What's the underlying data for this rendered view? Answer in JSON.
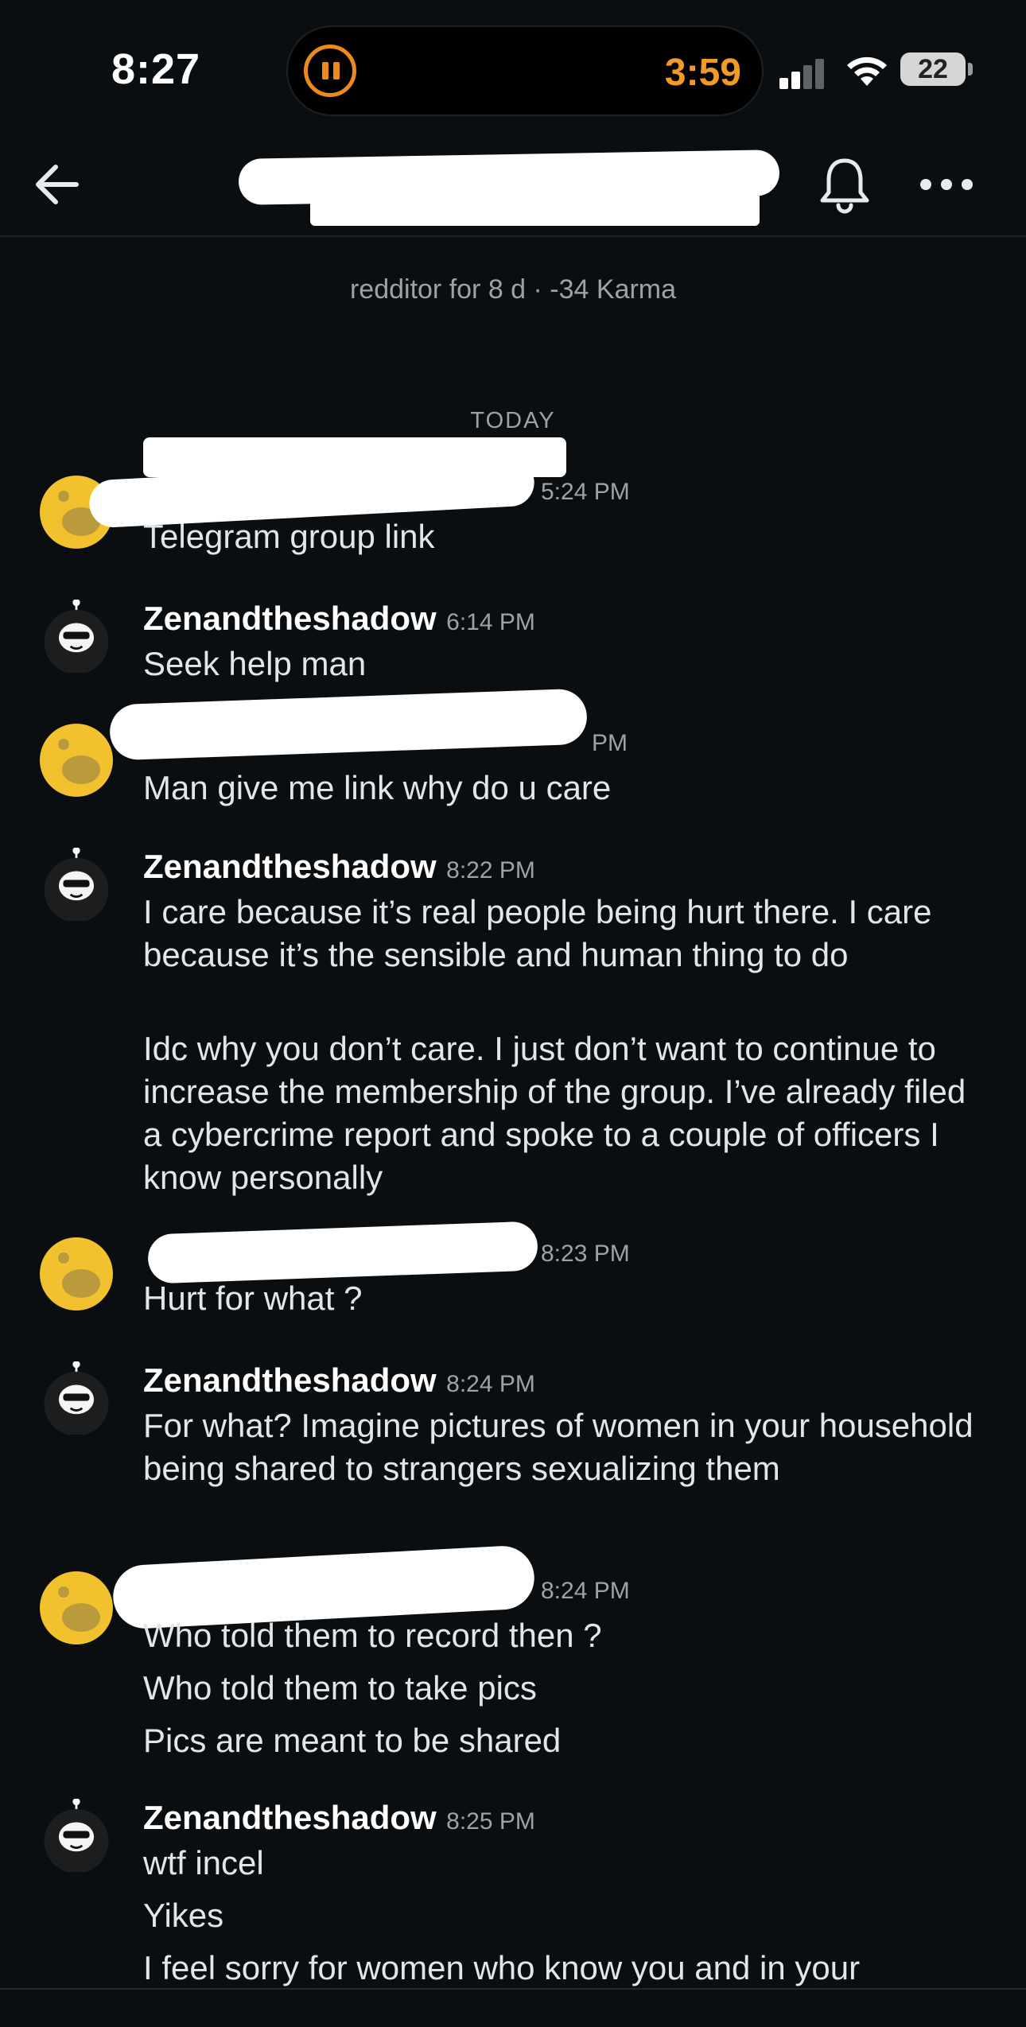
{
  "status_bar": {
    "time": "8:27",
    "island_timer": "3:59",
    "battery": "22",
    "accent_color": "#f19a25"
  },
  "nav": {
    "back_icon": "arrow-left-icon",
    "bell_icon": "bell-icon",
    "more_icon": "ellipsis-icon",
    "title": "[redacted username]"
  },
  "profile": {
    "subtitle": "redditor for 8 d · -34 Karma"
  },
  "divider": "TODAY",
  "messages": [
    {
      "user": "",
      "time": "5:24 PM",
      "lines": [
        "Telegram group link"
      ]
    },
    {
      "user": "Zenandtheshadow",
      "time": "6:14 PM",
      "lines": [
        "Seek help man"
      ]
    },
    {
      "user": "",
      "time": "PM",
      "lines": [
        "Man give me link why do u care"
      ]
    },
    {
      "user": "Zenandtheshadow",
      "time": "8:22 PM",
      "lines": [
        "I care because it’s real people being hurt there. I care because it’s the sensible and human thing to do",
        "Idc why you don’t care. I just don’t want to continue to increase the membership of the group. I’ve already filed a cybercrime report and spoke to a couple of officers I know personally"
      ]
    },
    {
      "user": "",
      "time": "8:23 PM",
      "lines": [
        "Hurt for what ?"
      ]
    },
    {
      "user": "Zenandtheshadow",
      "time": "8:24 PM",
      "lines": [
        "For what? Imagine pictures of women in your household being shared to strangers sexualizing them"
      ]
    },
    {
      "user": "",
      "time": "8:24 PM",
      "lines": [
        "Who told them to record then ?",
        "Who told them to take pics",
        "Pics are meant to be shared"
      ]
    },
    {
      "user": "Zenandtheshadow",
      "time": "8:25 PM",
      "lines": [
        "wtf incel",
        "Yikes",
        "I feel sorry for women who know you and in your"
      ]
    }
  ]
}
